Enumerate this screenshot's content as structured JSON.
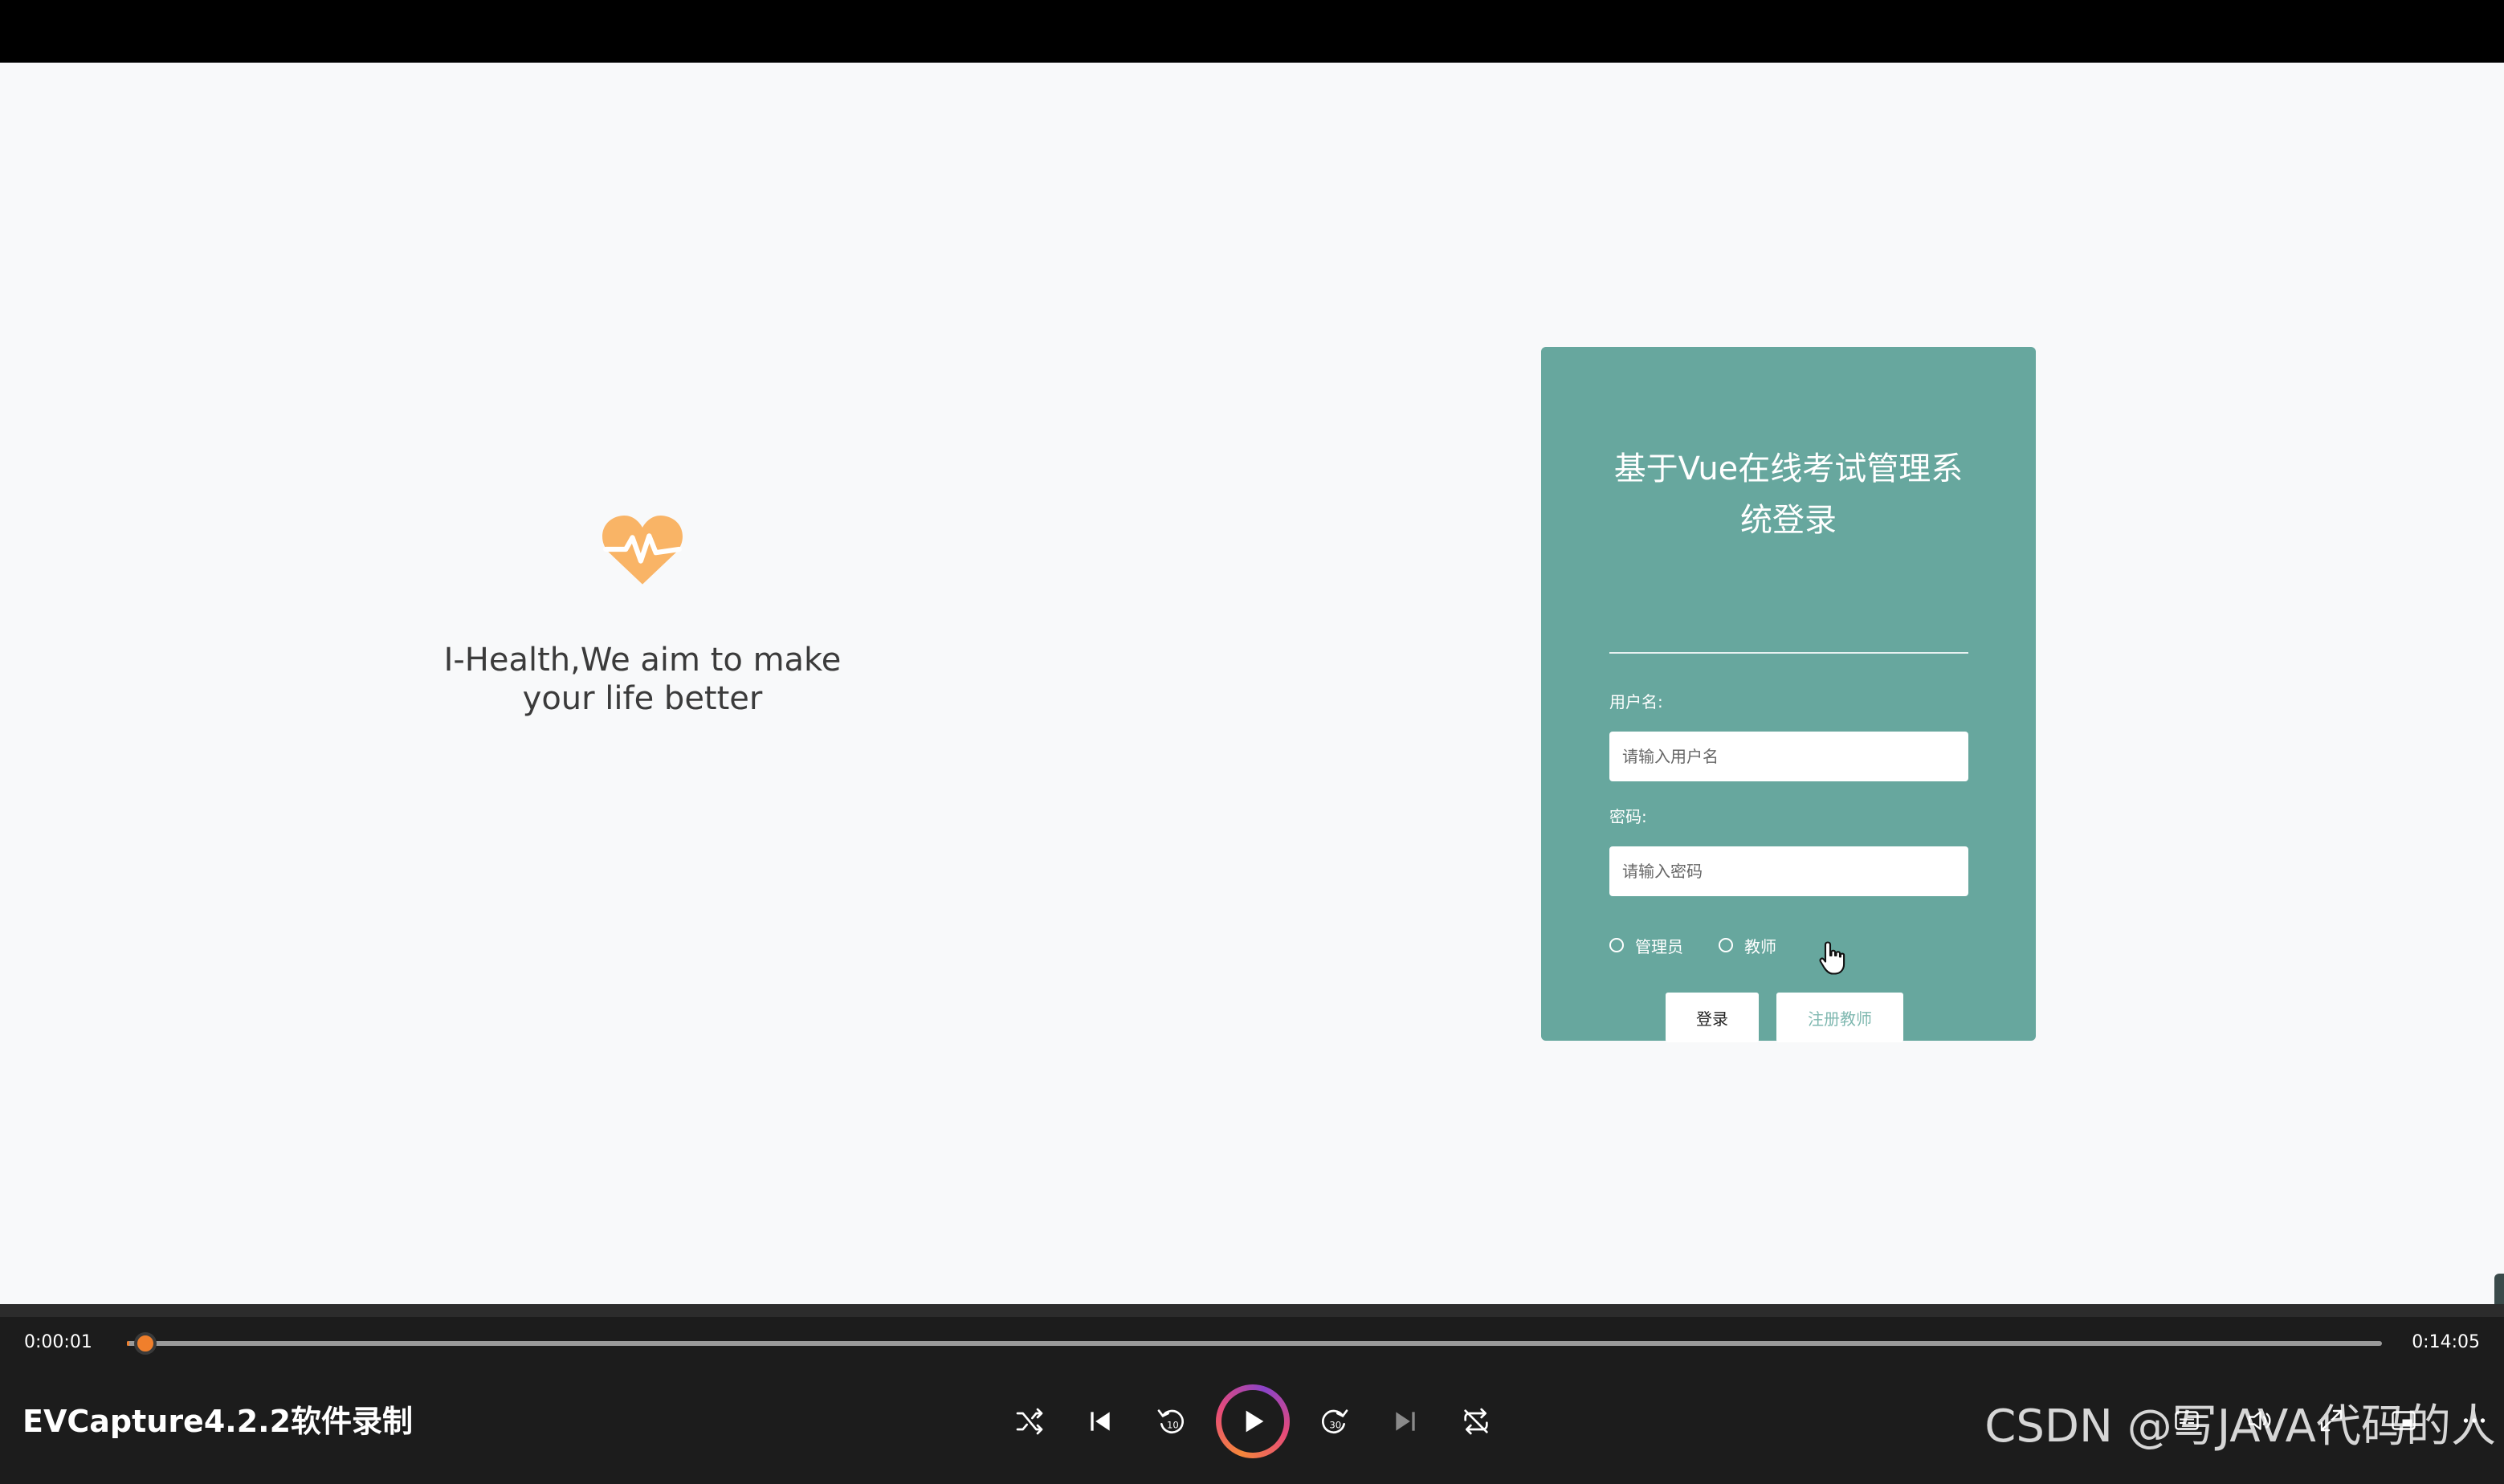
{
  "stage": {
    "hero": {
      "tagline_line1": "I-Health,We aim to make",
      "tagline_line2": "your life better"
    },
    "login": {
      "title_line1": "基于Vue在线考试管理系",
      "title_line2": "统登录",
      "username_label": "用户名:",
      "username_placeholder": "请输入用户名",
      "password_label": "密码:",
      "password_placeholder": "请输入密码",
      "roles": [
        "管理员",
        "教师"
      ],
      "login_button": "登录",
      "register_button": "注册教师"
    }
  },
  "player": {
    "elapsed": "0:00:01",
    "total": "0:14:05",
    "progress_fraction": 0.001,
    "title": "EVCapture4.2.2软件录制",
    "controls": [
      "shuffle-icon",
      "previous-icon",
      "rewind-10-icon",
      "play-icon",
      "forward-30-icon",
      "next-icon",
      "repeat-off-icon"
    ],
    "right_controls": [
      "subtitles-icon",
      "volume-icon",
      "fullscreen-icon",
      "miniplayer-icon",
      "more-icon"
    ],
    "accent_color": "#f07f2c"
  },
  "watermark": "CSDN @写JAVA代码的人",
  "colors": {
    "card": "#67a79e",
    "stage": "#f8f9fa",
    "heart": "#f9b466"
  }
}
